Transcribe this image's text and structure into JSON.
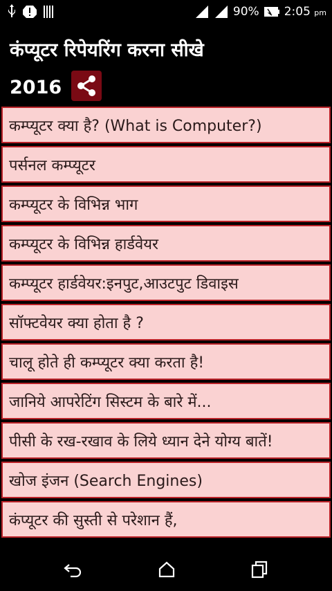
{
  "status": {
    "battery": "90%",
    "time": "2:05",
    "ampm": "pm"
  },
  "header": {
    "title": "कंप्यूटर रिपेयरिंग करना सीखे",
    "year": "2016"
  },
  "items": [
    "कम्प्यूटर क्या है? (What is Computer?)",
    "पर्सनल कम्प्यूटर",
    "कम्प्यूटर के विभिन्न भाग",
    "कम्प्यूटर के विभिन्न हार्डवेयर",
    "कम्प्यूटर हार्डवेयर:इनपुट,आउटपुट डिवाइस",
    "सॉफ्टवेयर क्या होता है ?",
    "चालू होते ही कम्प्यूटर क्या करता है!",
    "जानिये आपरेटिंग सिस्टम के बारे में...",
    "पीसी के रख-रखाव के लिये ध्यान देने योग्य बातें!",
    "खोज इंजन (Search Engines)",
    "कंप्यूटर की सुस्ती से परेशान हैं,"
  ],
  "colors": {
    "item_bg": "#fad2d2",
    "item_border": "#b92228",
    "share_bg": "#7a0a14"
  }
}
